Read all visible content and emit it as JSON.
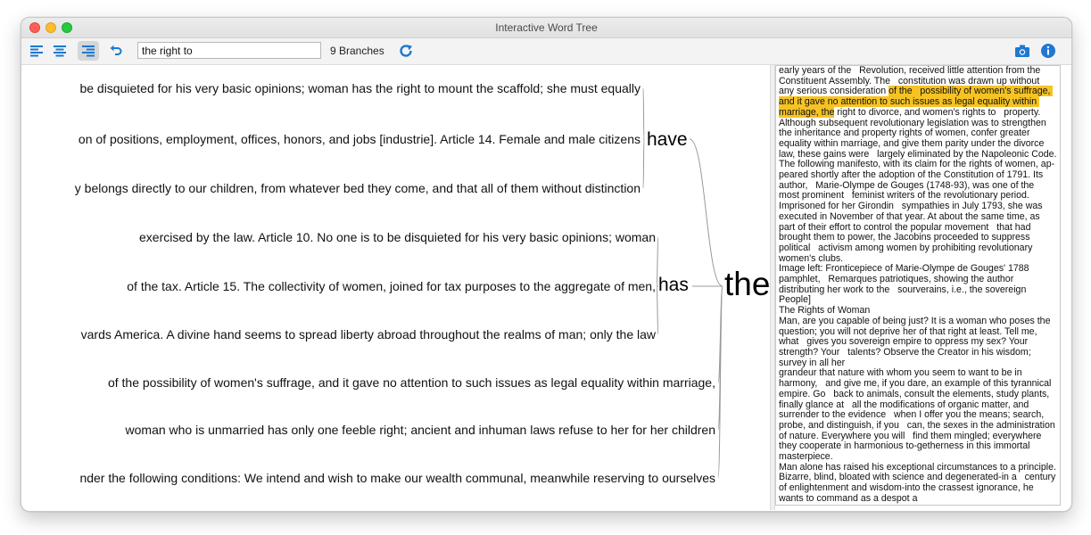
{
  "window": {
    "title": "Interactive Word Tree"
  },
  "toolbar": {
    "search_value": "the right to",
    "branches_label": "9 Branches"
  },
  "tree": {
    "root": "the",
    "groups": [
      {
        "word": "have",
        "leaves": [
          "be disquieted for his very basic opinions; woman has the right to mount the scaffold; she must equally",
          "on of positions, employment, offices, honors, and jobs [industrie]. Article 14. Female and male citizens",
          "y belongs directly to our children, from whatever bed they come, and that all of them without distinction"
        ]
      },
      {
        "word": "has",
        "leaves": [
          "exercised by the law. Article 10. No one is to be disquieted for his very basic opinions; woman",
          "of the tax. Article 15. The collectivity of women, joined for tax purposes to the aggregate of men,",
          "vards America. A divine hand seems to spread liberty abroad throughout the realms of man; only the law"
        ]
      }
    ],
    "direct_leaves": [
      "of the possibility of women's suffrage, and it gave no attention to such issues as legal equality within marriage,",
      "woman who is unmarried has only one feeble right; ancient and inhuman laws refuse to her for her children",
      "nder the following conditions: We intend and wish to make our wealth communal, meanwhile reserving to ourselves"
    ]
  },
  "reader": {
    "text_before": "early years of the   Revolution, received little attention from the Constituent Assembly. The   constitution was drawn up without any serious consideration ",
    "highlight": "of the   possibility of women's suffrage, and it gave no attention to such issues as legal equality within marriage, the",
    "text_after": " right to divorce, and women's rights to   property. Although subsequent revolutionary legislation was to strengthen   the inheritance and property rights of women, confer greater equality within marriage, and give them parity under the divorce law, these gains were   largely eliminated by the Napoleonic Code.\nThe following manifesto, with its claim for the rights of women, ap-  peared shortly after the adoption of the Constitution of 1791. Its author,   Marie-Olympe de Gouges (1748-93), was one of the most prominent   feminist writers of the revolutionary period. Imprisoned for her Girondin   sympathies in July 1793, she was executed in November of that year. At about the same time, as part of their effort to control the popular movement   that had brought them to power, the Jacobins proceeded to suppress political   activism among women by prohibiting revolutionary women's clubs.\nImage left: Fronticepiece of Marie-Olympe de Gouges' 1788 pamphlet,   Remarques patriotiques, showing the author distributing her work to the   sourverains, i.e., the sovereign People]\nThe Rights of Woman\nMan, are you capable of being just? It is a woman who poses the   question; you will not deprive her of that right at least. Tell me, what   gives you sovereign empire to oppress my sex? Your strength? Your   talents? Observe the Creator in his wisdom; survey in all her\ngrandeur that nature with whom you seem to want to be in harmony,   and give me, if you dare, an example of this tyrannical empire. Go   back to animals, consult the elements, study plants, finally glance at   all the modifications of organic matter, and surrender to the evidence   when I offer you the means; search, probe, and distinguish, if you   can, the sexes in the administration of nature. Everywhere you will   find them mingled; everywhere they cooperate in harmonious to-getherness in this immortal masterpiece.\nMan alone has raised his exceptional circumstances to a principle. Bizarre, blind, bloated with science and degenerated-in a   century of enlightenment and wisdom-into the crassest ignorance, he   wants to command as a despot a"
  }
}
